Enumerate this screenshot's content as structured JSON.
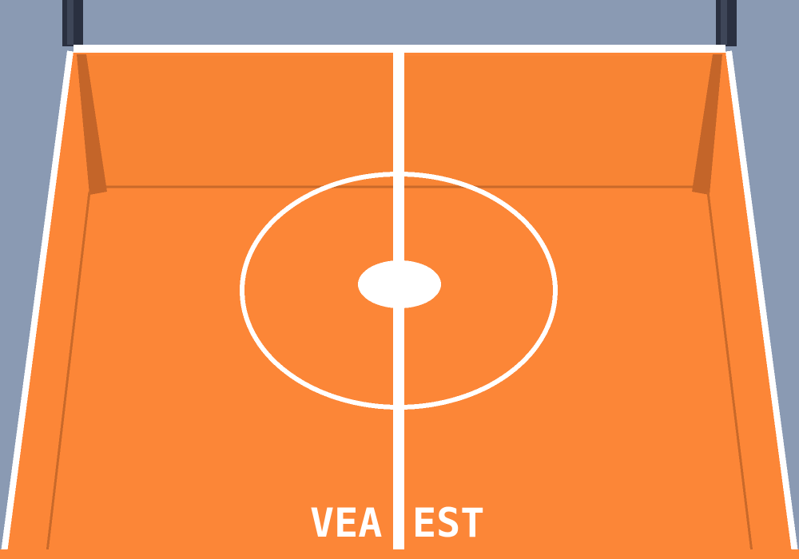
{
  "court": {
    "text_left": "VEA",
    "text_right": "EST"
  },
  "colors": {
    "background": "#8a9ab3",
    "court_floor": "#fc8637",
    "court_shadow": "#d06d2d",
    "wall_shade": "#b9622a",
    "line": "#ffffff",
    "post": "#2a3040"
  }
}
